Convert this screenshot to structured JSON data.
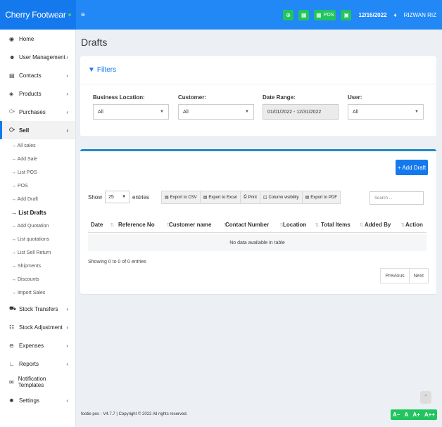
{
  "brand": {
    "name": "Cherry Footwear"
  },
  "topbar": {
    "menu_icon": "hamburger-icon",
    "pos_label": "POS",
    "date": "12/16/2022",
    "user": "RIZWAN RIZ"
  },
  "sidebar": {
    "items": [
      {
        "label": "Home",
        "icon": "dashboard-icon",
        "chevron": ""
      },
      {
        "label": "User Management",
        "icon": "users-icon",
        "chevron": "‹"
      },
      {
        "label": "Contacts",
        "icon": "address-book-icon",
        "chevron": "‹"
      },
      {
        "label": "Products",
        "icon": "cubes-icon",
        "chevron": "‹"
      },
      {
        "label": "Purchases",
        "icon": "arrow-circle-down-icon",
        "chevron": "‹"
      },
      {
        "label": "Sell",
        "icon": "arrow-circle-up-icon",
        "chevron": "‹"
      }
    ],
    "sell_subitems": [
      "→ All sales",
      "→ Add Sale",
      "→ List POS",
      "→ POS",
      "→ Add Draft",
      "→ List Drafts",
      "→ Add Quotation",
      "→ List quotations",
      "→ List Sell Return",
      "→ Shipments",
      "→ Discounts",
      "→ Import Sales"
    ],
    "items_after": [
      {
        "label": "Stock Transfers",
        "icon": "truck-icon",
        "chevron": "‹"
      },
      {
        "label": "Stock Adjustment",
        "icon": "database-icon",
        "chevron": "‹"
      },
      {
        "label": "Expenses",
        "icon": "minus-circle-icon",
        "chevron": "‹"
      },
      {
        "label": "Reports",
        "icon": "chart-icon",
        "chevron": "‹"
      },
      {
        "label": "Notification Templates",
        "icon": "envelope-icon",
        "chevron": ""
      },
      {
        "label": "Settings",
        "icon": "cog-icon",
        "chevron": "‹"
      }
    ]
  },
  "page": {
    "title": "Drafts"
  },
  "filters": {
    "title": "Filters",
    "business_location": {
      "label": "Business Location:",
      "value": "All"
    },
    "customer": {
      "label": "Customer:",
      "value": "All"
    },
    "date_range": {
      "label": "Date Range:",
      "value": "01/01/2022 - 12/31/2022"
    },
    "user": {
      "label": "User:",
      "value": "All"
    }
  },
  "drafts_table": {
    "add_button": "+ Add Draft",
    "show_label": "Show",
    "page_length": "25",
    "entries_label": "entries",
    "export_buttons": [
      "Export to CSV",
      "Export to Excel",
      "Print",
      "Column visibility",
      "Export to PDF"
    ],
    "search_placeholder": "Search ...",
    "columns": [
      "Date",
      "Reference No",
      "Customer name",
      "Contact Number",
      "Location",
      "Total Items",
      "Added By",
      "Action"
    ],
    "empty_message": "No data available in table",
    "info": "Showing 0 to 0 of 0 entries",
    "pagination": {
      "previous": "Previous",
      "next": "Next"
    }
  },
  "footer": {
    "text": "footie pos - V4.7.7 | Copyright © 2022 All rights reserved.",
    "font_controls": [
      "A−",
      "A",
      "A+",
      "A++"
    ]
  },
  "colors": {
    "primary": "#1579ee",
    "topbar": "#2288f5",
    "success": "#21c45f",
    "box_border": "#1f8ac2"
  }
}
